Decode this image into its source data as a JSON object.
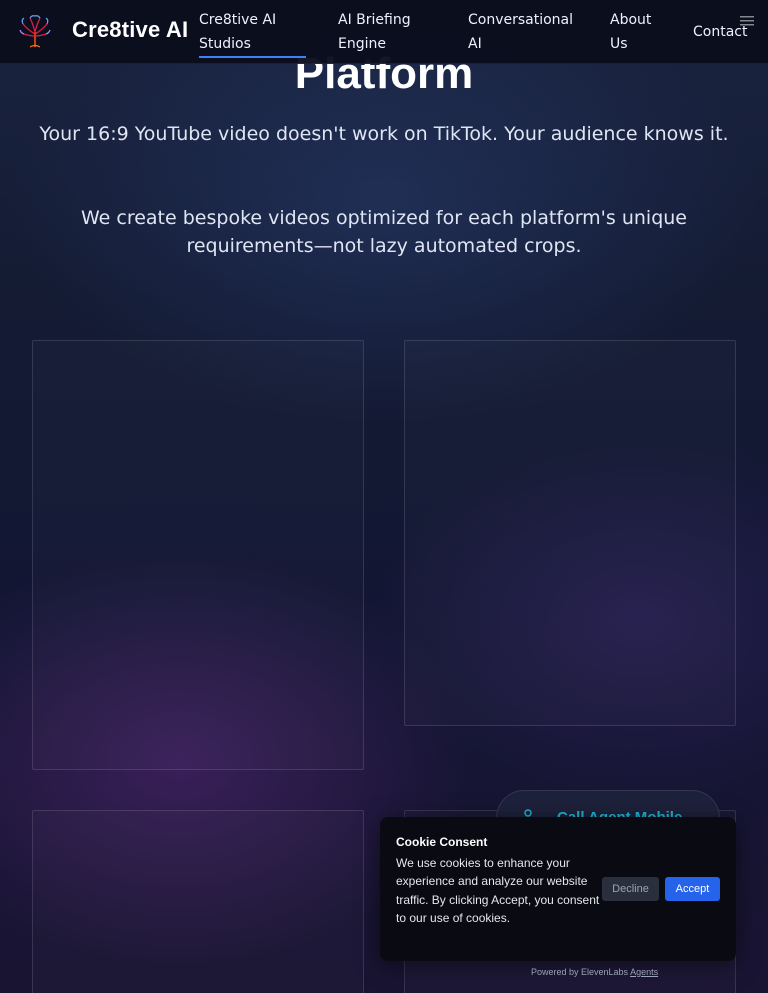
{
  "header": {
    "brand": "Cre8tive AI",
    "logo_icon": "tree-logo-icon",
    "nav": [
      {
        "label": "Cre8tive AI Studios",
        "active": true
      },
      {
        "label": "AI Briefing Engine",
        "active": false
      },
      {
        "label": "Conversational AI",
        "active": false
      },
      {
        "label": "About Us",
        "active": false
      },
      {
        "label": "Contact",
        "active": false
      }
    ],
    "menu_icon": "hamburger-menu-icon"
  },
  "hero": {
    "title": "Platform",
    "paragraph1": "Your 16:9 YouTube video doesn't work on TikTok. Your audience knows it.",
    "paragraph2": "We create bespoke videos optimized for each platform's unique requirements—not lazy automated crops."
  },
  "call_agent": {
    "label": "Call Agent Mobile",
    "icon": "person-icon"
  },
  "cookie": {
    "title": "Cookie Consent",
    "body": "We use cookies to enhance your experience and analyze our website traffic. By clicking Accept, you consent to our use of cookies.",
    "decline_label": "Decline",
    "accept_label": "Accept",
    "powered_text": "Powered by ElevenLabs",
    "powered_link": "Agents"
  },
  "colors": {
    "accent": "#3b82f6",
    "accept": "#2563eb",
    "call_text": "#1fb8d6"
  }
}
